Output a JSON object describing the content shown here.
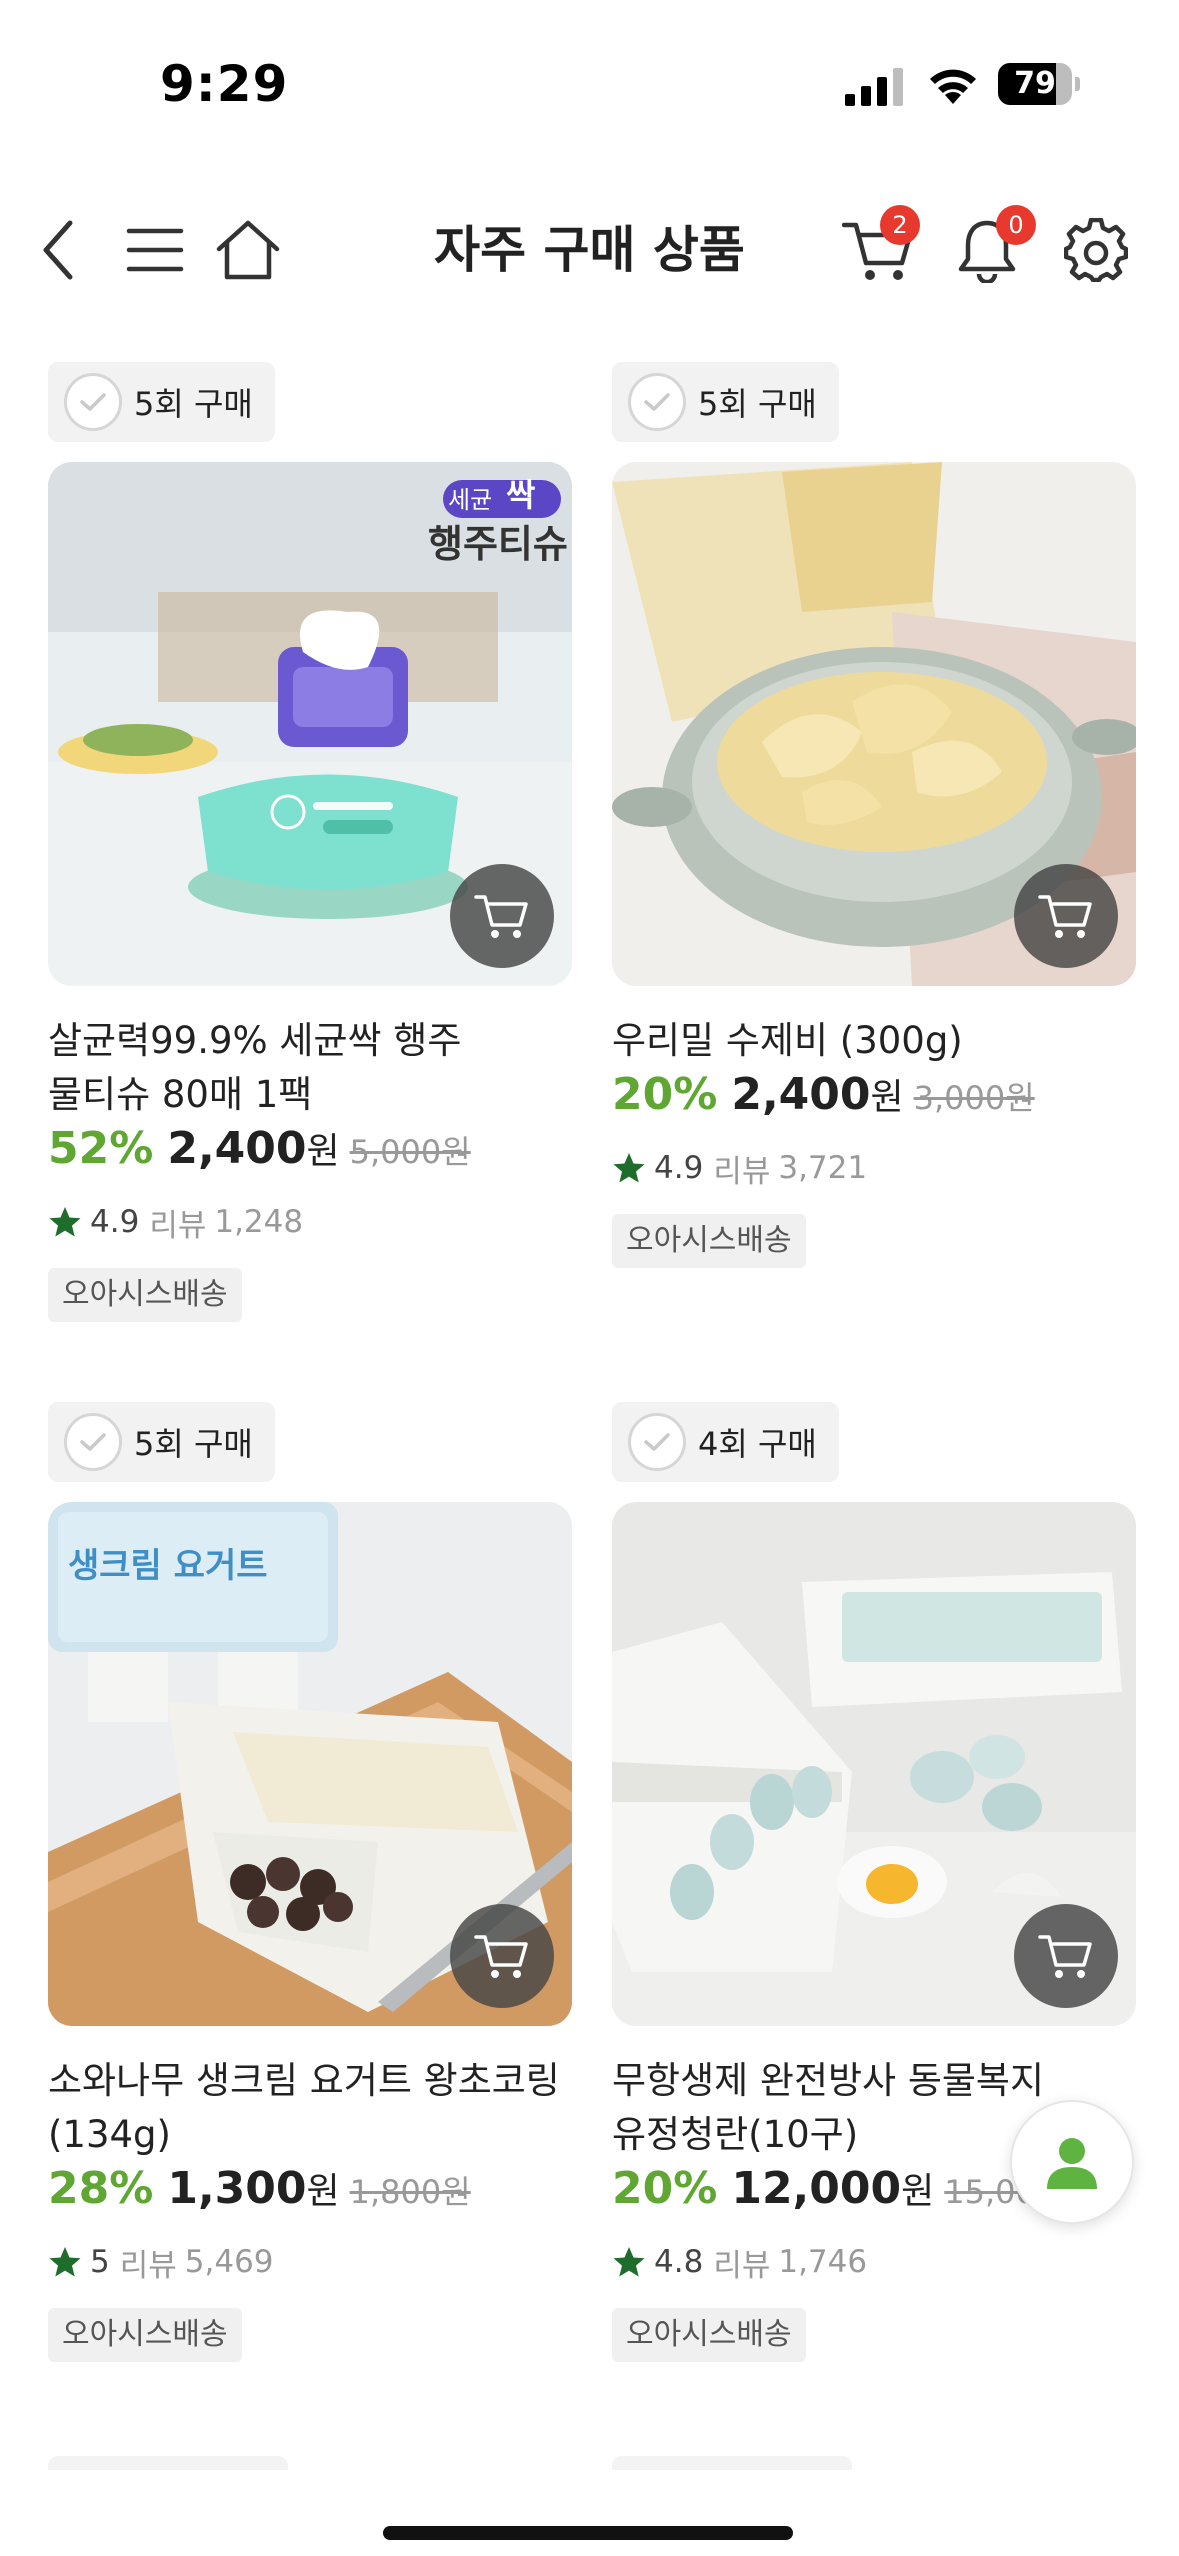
{
  "status": {
    "time": "9:29",
    "battery": "79",
    "battery_level": 0.79
  },
  "header": {
    "title": "자주 구매 상품",
    "cart_count": "2",
    "notification_count": "0"
  },
  "colors": {
    "discount": "#5fa632",
    "badge": "#e8392f",
    "star": "#1f6d2a"
  },
  "products": [
    {
      "purchase_count": "5회 구매",
      "name": "살균력99.9% 세균싹 행주 물티슈 80매 1팩",
      "discount": "52%",
      "price": "2,400",
      "currency": "원",
      "original_price": "5,000원",
      "rating": "4.9",
      "review_label": "리뷰",
      "review_count": "1,248",
      "delivery": "오아시스배송",
      "image_text": {
        "line1": "세균",
        "highlight": "싹",
        "line2": "행주티슈"
      }
    },
    {
      "purchase_count": "5회 구매",
      "name": "우리밀 수제비 (300g)",
      "discount": "20%",
      "price": "2,400",
      "currency": "원",
      "original_price": "3,000원",
      "rating": "4.9",
      "review_label": "리뷰",
      "review_count": "3,721",
      "delivery": "오아시스배송"
    },
    {
      "purchase_count": "5회 구매",
      "name": "소와나무 생크림 요거트 왕초코링(134g)",
      "discount": "28%",
      "price": "1,300",
      "currency": "원",
      "original_price": "1,800원",
      "rating": "5",
      "review_label": "리뷰",
      "review_count": "5,469",
      "delivery": "오아시스배송"
    },
    {
      "purchase_count": "4회 구매",
      "name": "무항생제 완전방사 동물복지 유정청란(10구)",
      "discount": "20%",
      "price": "12,000",
      "currency": "원",
      "original_price": "15,000원",
      "rating": "4.8",
      "review_label": "리뷰",
      "review_count": "1,746",
      "delivery": "오아시스배송"
    }
  ]
}
